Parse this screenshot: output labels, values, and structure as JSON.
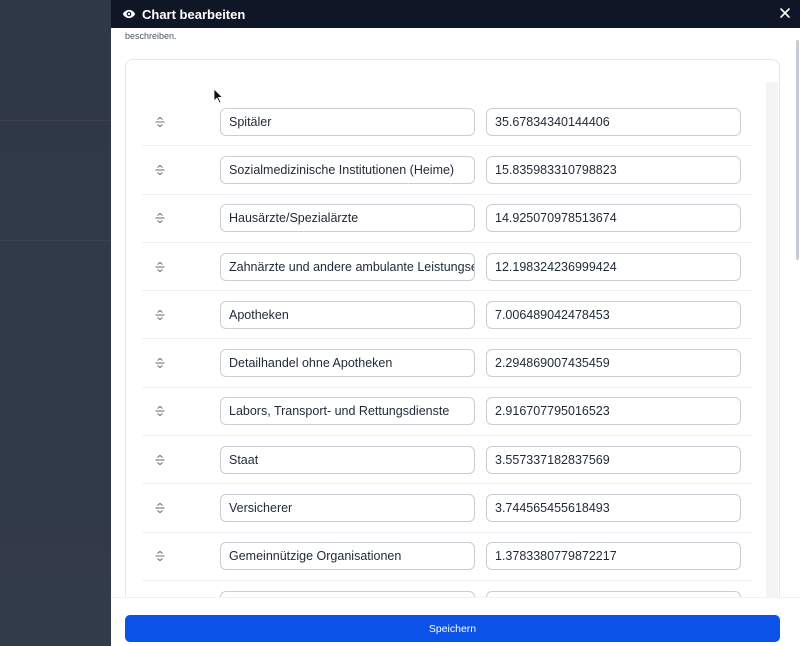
{
  "drawer": {
    "title": "Chart bearbeiten",
    "description": "beschreiben.",
    "save_label": "Speichern"
  },
  "rows": [
    {
      "name": "Spitäler",
      "value": "35.67834340144406"
    },
    {
      "name": "Sozialmedizinische Institutionen (Heime)",
      "value": "15.835983310798823"
    },
    {
      "name": "Hausärzte/Spezialärzte",
      "value": "14.925070978513674"
    },
    {
      "name": "Zahnärzte und andere ambulante Leistungser",
      "value": "12.198324236999424"
    },
    {
      "name": "Apotheken",
      "value": "7.006489042478453"
    },
    {
      "name": "Detailhandel ohne Apotheken",
      "value": "2.294869007435459"
    },
    {
      "name": "Labors, Transport- und Rettungsdienste",
      "value": "2.916707795016523"
    },
    {
      "name": "Staat",
      "value": "3.557337182837569"
    },
    {
      "name": "Versicherer",
      "value": "3.744565455618493"
    },
    {
      "name": "Gemeinnützige Organisationen",
      "value": "1.3783380779872217"
    },
    {
      "name": "",
      "value": ""
    }
  ],
  "icons": {
    "header": "eye-icon",
    "close": "close-icon",
    "drag": "drag-handle-icon",
    "cursor": "mouse-pointer-icon"
  },
  "colors": {
    "header_bg": "#0f1626",
    "primary": "#0b52e8",
    "backdrop": "#2b3444"
  }
}
